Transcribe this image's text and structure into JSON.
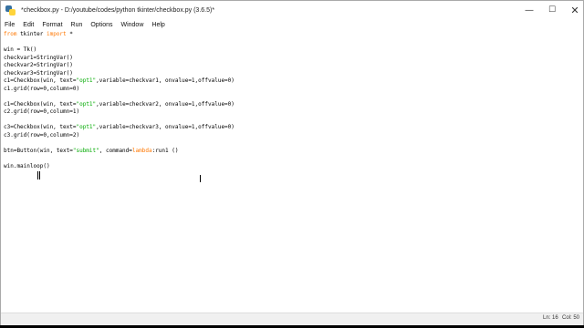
{
  "window": {
    "title": "*checkbox.py - D:/youtube/codes/python tkinter/checkbox.py (3.6.5)*",
    "controls": {
      "minimize": "—",
      "maximize": "☐",
      "close": "✕"
    }
  },
  "menu": [
    "File",
    "Edit",
    "Format",
    "Run",
    "Options",
    "Window",
    "Help"
  ],
  "code": [
    [
      {
        "t": "from",
        "c": "kw"
      },
      {
        "t": " tkinter ",
        "c": ""
      },
      {
        "t": "import",
        "c": "kw"
      },
      {
        "t": " *",
        "c": ""
      }
    ],
    [],
    [
      {
        "t": "win = Tk()",
        "c": ""
      }
    ],
    [
      {
        "t": "checkvar1=StringVar()",
        "c": ""
      }
    ],
    [
      {
        "t": "checkvar2=StringVar()",
        "c": ""
      }
    ],
    [
      {
        "t": "checkvar3=StringVar()",
        "c": ""
      }
    ],
    [
      {
        "t": "c1=Checkbox(win, text=",
        "c": ""
      },
      {
        "t": "\"opt1\"",
        "c": "str"
      },
      {
        "t": ",variable=checkvar1, onvalue=1,offvalue=0)",
        "c": ""
      }
    ],
    [
      {
        "t": "c1.grid(row=0,column=0)",
        "c": ""
      }
    ],
    [],
    [
      {
        "t": "c1=Checkbox(win, text=",
        "c": ""
      },
      {
        "t": "\"opt1\"",
        "c": "str"
      },
      {
        "t": ",variable=checkvar2, onvalue=1,offvalue=0)",
        "c": ""
      }
    ],
    [
      {
        "t": "c2.grid(row=0,column=1)",
        "c": ""
      }
    ],
    [],
    [
      {
        "t": "c3=Checkbox(win, text=",
        "c": ""
      },
      {
        "t": "\"opt1\"",
        "c": "str"
      },
      {
        "t": ",variable=checkvar3, onvalue=1,offvalue=0)",
        "c": ""
      }
    ],
    [
      {
        "t": "c3.grid(row=0,column=2)",
        "c": ""
      }
    ],
    [],
    [
      {
        "t": "btn=Button(win, text=",
        "c": ""
      },
      {
        "t": "\"submit\"",
        "c": "str"
      },
      {
        "t": ", command=",
        "c": ""
      },
      {
        "t": "lambda",
        "c": "kw"
      },
      {
        "t": ":run1 ()",
        "c": ""
      }
    ],
    [],
    [
      {
        "t": "win.mainloop()",
        "c": ""
      }
    ]
  ],
  "status": {
    "line": "Ln: 16",
    "col": "Col: 50"
  }
}
